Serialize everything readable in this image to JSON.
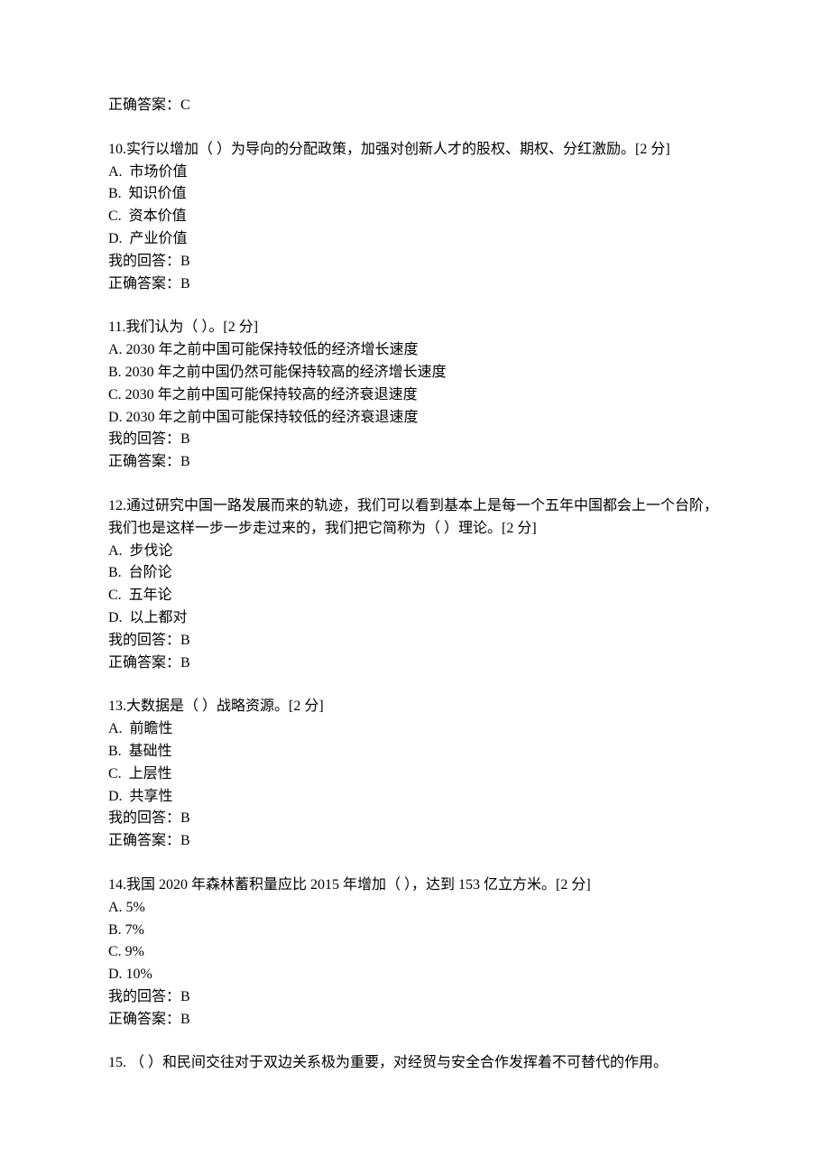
{
  "header_correct": "正确答案：C",
  "questions": [
    {
      "num": "10",
      "stem_pre": "实行以增加（ ）为导向的分配政策，加强对创新人才的股权、期权、分红激励。",
      "points": "[2 分]",
      "A": "A.  市场价值",
      "B": "B.  知识价值",
      "C": "C.  资本价值",
      "D": "D.  产业价值",
      "my": "我的回答：B",
      "correct": "正确答案：B"
    },
    {
      "num": "11",
      "stem_pre": "我们认为（ ）。",
      "points": "[2 分]",
      "A": "A. 2030 年之前中国可能保持较低的经济增长速度",
      "B": "B. 2030 年之前中国仍然可能保持较高的经济增长速度",
      "C": "C. 2030 年之前中国可能保持较高的经济衰退速度",
      "D": "D. 2030 年之前中国可能保持较低的经济衰退速度",
      "my": "我的回答：B",
      "correct": "正确答案：B"
    },
    {
      "num": "12",
      "stem_pre": "通过研究中国一路发展而来的轨迹，我们可以看到基本上是每一个五年中国都会上一个台阶，我们也是这样一步一步走过来的，我们把它简称为（ ）理论。",
      "points": "[2 分]",
      "A": "A.  步伐论",
      "B": "B.  台阶论",
      "C": "C.  五年论",
      "D": "D.  以上都对",
      "my": "我的回答：B",
      "correct": "正确答案：B"
    },
    {
      "num": "13",
      "stem_pre": "大数据是（ ）战略资源。",
      "points": "[2 分]",
      "A": "A.  前瞻性",
      "B": "B.  基础性",
      "C": "C.  上层性",
      "D": "D.  共享性",
      "my": "我的回答：B",
      "correct": "正确答案：B"
    },
    {
      "num": "14",
      "stem_pre": "我国 2020 年森林蓄积量应比 2015 年增加（ ），达到 153 亿立方米。",
      "points": "[2 分]",
      "A": "A. 5%",
      "B": "B. 7%",
      "C": "C. 9%",
      "D": "D. 10%",
      "my": "我的回答：B",
      "correct": "正确答案：B"
    }
  ],
  "q15": {
    "num": "15",
    "stem": "（ ）和民间交往对于双边关系极为重要，对经贸与安全合作发挥着不可替代的作用。"
  }
}
